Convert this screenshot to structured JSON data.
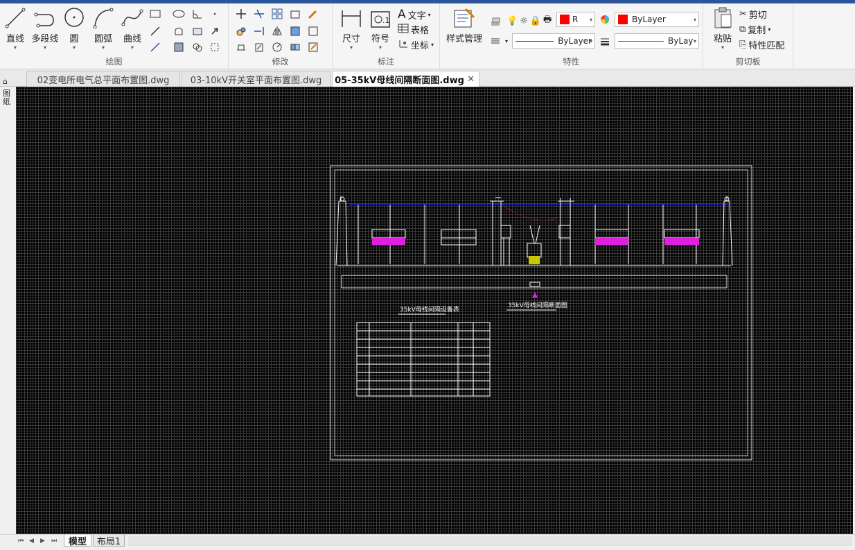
{
  "ribbon": {
    "draw": {
      "label": "绘图",
      "line": "直线",
      "polyline": "多段线",
      "circle": "圆",
      "arc": "圆弧",
      "curve": "曲线"
    },
    "modify": {
      "label": "修改"
    },
    "annotate": {
      "label": "标注",
      "dimension": "尺寸",
      "symbol": "符号",
      "text": "文字",
      "table": "表格",
      "coordinate": "坐标"
    },
    "style": {
      "label": "样式管理"
    },
    "properties": {
      "label": "特性",
      "color_value": "R",
      "color_name": "ByLayer",
      "linetype": "ByLayer",
      "lineweight": "ByLay"
    },
    "clipboard": {
      "label": "剪切板",
      "paste": "粘贴",
      "cut": "剪切",
      "copy": "复制",
      "match": "特性匹配"
    }
  },
  "doc_tabs": [
    {
      "label": "02变电所电气总平面布置图.dwg",
      "active": false
    },
    {
      "label": "03-10kV开关室平面布置图.dwg",
      "active": false
    },
    {
      "label": "05-35kV母线间隔断面图.dwg",
      "active": true
    }
  ],
  "side_panel_label": "图纸",
  "drawing": {
    "section_title": "35kV母线间隔断面图",
    "table_title": "35kV母线间隔设备表"
  },
  "layout_tabs": [
    {
      "label": "模型",
      "active": true
    },
    {
      "label": "布局1",
      "active": false
    }
  ],
  "colors": {
    "accent": "#2b579a",
    "current_color": "#ff0000",
    "canvas_bg": "#000000",
    "bus_line": "#1a1ab8",
    "magenta_label": "#e020e0"
  }
}
